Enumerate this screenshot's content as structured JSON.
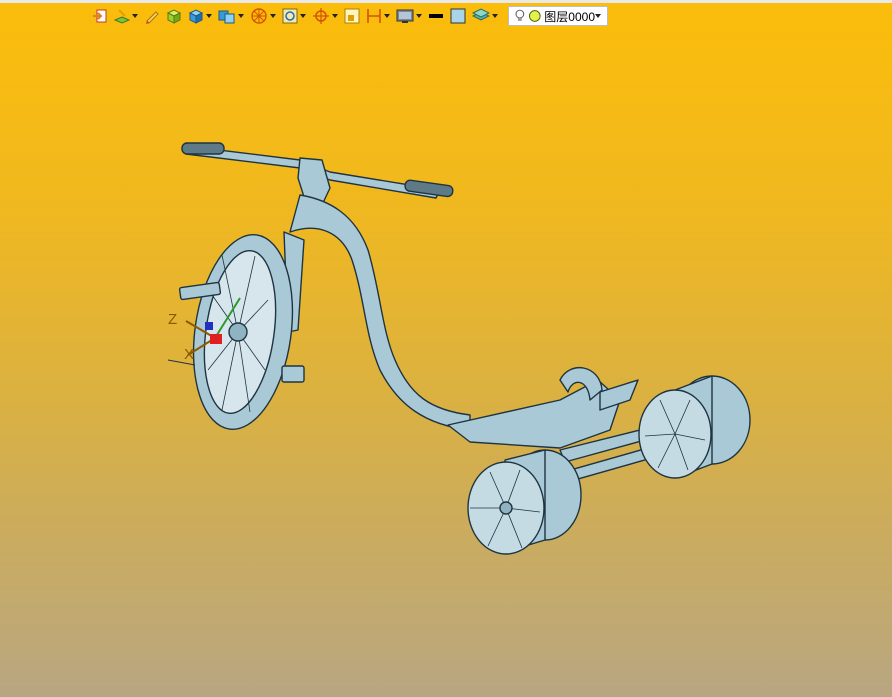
{
  "toolbar": {
    "items": [
      {
        "name": "import-icon",
        "dropdown": false
      },
      {
        "name": "sketch-plane-icon",
        "dropdown": true
      },
      {
        "name": "pencil-icon",
        "dropdown": false
      },
      {
        "name": "extrude-box-icon",
        "dropdown": false
      },
      {
        "name": "solid-cube-icon",
        "dropdown": true
      },
      {
        "name": "boolean-icon",
        "dropdown": true
      },
      {
        "name": "wheel-view-icon",
        "dropdown": true
      },
      {
        "name": "fit-view-icon",
        "dropdown": true
      },
      {
        "name": "crosshair-snap-icon",
        "dropdown": true
      },
      {
        "name": "select-filter-icon",
        "dropdown": false
      },
      {
        "name": "measure-icon",
        "dropdown": true
      },
      {
        "name": "display-mode-icon",
        "dropdown": true
      },
      {
        "name": "line-color-icon",
        "dropdown": false
      },
      {
        "name": "fill-color-icon",
        "dropdown": false
      },
      {
        "name": "layer-stack-icon",
        "dropdown": true
      }
    ],
    "layer": {
      "name": "图层0000",
      "bulb_icon": "bulb-icon",
      "color_icon": "layer-color-dot-icon"
    }
  },
  "viewport": {
    "axis_labels": {
      "z": "Z",
      "x": "X"
    },
    "model": "tricycle-3d-model",
    "colors": {
      "background_top": "#fbbd0a",
      "background_bottom": "#b8a682",
      "model": "#a9c9d6",
      "model_edge": "#1e3440"
    }
  }
}
